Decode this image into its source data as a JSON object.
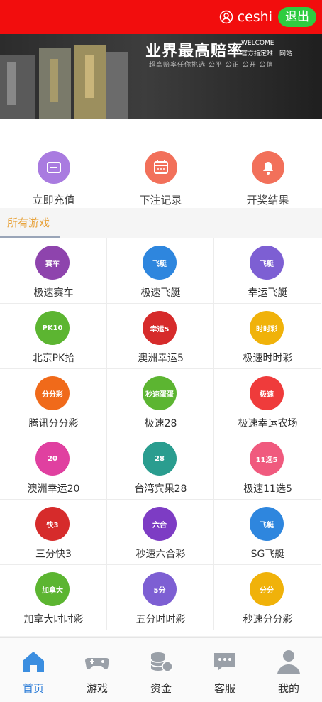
{
  "header": {
    "username": "ceshi",
    "logout_label": "退出",
    "user_icon": "user-circle-icon"
  },
  "banner": {
    "title": "业界最高赔率",
    "subtitle_line1": "WELCOME",
    "subtitle_line2": "官方指定唯一网站",
    "tagline": "超高赔率任你挑选 公平 公正 公开 公信",
    "slide_count": 3,
    "active_slide": 3
  },
  "actions": [
    {
      "label": "立即充值",
      "icon": "recharge-icon",
      "color": "#a97be0"
    },
    {
      "label": "下注记录",
      "icon": "calendar-icon",
      "color": "#f2705a"
    },
    {
      "label": "开奖结果",
      "icon": "bell-icon",
      "color": "#f2705a"
    }
  ],
  "section": {
    "title": "所有游戏"
  },
  "games": [
    {
      "name": "极速赛车",
      "badge": "赛车",
      "color": "#8e44ad"
    },
    {
      "name": "极速飞艇",
      "badge": "飞艇",
      "color": "#2e86de"
    },
    {
      "name": "幸运飞艇",
      "badge": "飞艇",
      "color": "#7d5fd3"
    },
    {
      "name": "北京PK拾",
      "badge": "PK10",
      "color": "#5cb531"
    },
    {
      "name": "澳洲幸运5",
      "badge": "幸运5",
      "color": "#d62b2b"
    },
    {
      "name": "极速时时彩",
      "badge": "时时彩",
      "color": "#f0b20a"
    },
    {
      "name": "腾讯分分彩",
      "badge": "分分彩",
      "color": "#f06a1a"
    },
    {
      "name": "极速28",
      "badge": "秒速蛋蛋",
      "color": "#5cb531"
    },
    {
      "name": "极速幸运农场",
      "badge": "极速",
      "color": "#ef3b3b"
    },
    {
      "name": "澳洲幸运20",
      "badge": "20",
      "color": "#e040a0"
    },
    {
      "name": "台湾宾果28",
      "badge": "28",
      "color": "#2a9d8f"
    },
    {
      "name": "极速11选5",
      "badge": "11选5",
      "color": "#f05a7e"
    },
    {
      "name": "三分快3",
      "badge": "快3",
      "color": "#d62b2b"
    },
    {
      "name": "秒速六合彩",
      "badge": "六合",
      "color": "#7d3cc4"
    },
    {
      "name": "SG飞艇",
      "badge": "飞艇",
      "color": "#2e86de"
    },
    {
      "name": "加拿大时时彩",
      "badge": "加拿大",
      "color": "#5cb531"
    },
    {
      "name": "五分时时彩",
      "badge": "5分",
      "color": "#7d5fd3"
    },
    {
      "name": "秒速分分彩",
      "badge": "分分",
      "color": "#f0b20a"
    }
  ],
  "tabbar": [
    {
      "label": "首页",
      "icon": "home-icon",
      "active": true
    },
    {
      "label": "游戏",
      "icon": "gamepad-icon",
      "active": false
    },
    {
      "label": "资金",
      "icon": "coins-icon",
      "active": false
    },
    {
      "label": "客服",
      "icon": "chat-icon",
      "active": false
    },
    {
      "label": "我的",
      "icon": "person-icon",
      "active": false
    }
  ]
}
